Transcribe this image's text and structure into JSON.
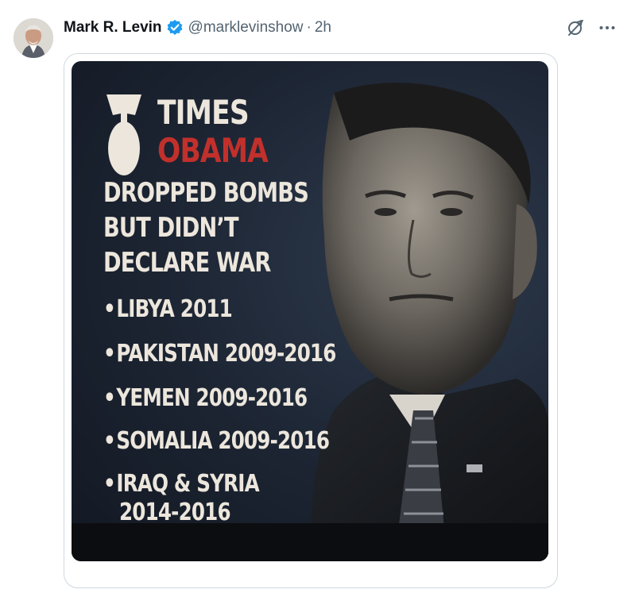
{
  "post": {
    "author": {
      "display_name": "Mark R. Levin",
      "handle": "@marklevinshow",
      "separator": "·",
      "time": "2h",
      "verified": true
    },
    "actions": {
      "grok_icon": "grok-icon",
      "more_icon": "more-icon"
    },
    "media": {
      "poster": {
        "headline_top": "TIMES",
        "headline_name": "OBAMA",
        "headline_lines": [
          "DROPPED BOMBS",
          "BUT DIDN’T",
          "DECLARE WAR"
        ],
        "bullet": "•",
        "list": [
          [
            "LIBYA 2011"
          ],
          [
            "PAKISTAN 2009-2016"
          ],
          [
            "YEMEN 2009-2016"
          ],
          [
            "SOMALIA 2009-2016"
          ],
          [
            "IRAQ & SYRIA",
            "2014-2016"
          ]
        ]
      }
    }
  },
  "colors": {
    "verified_blue": "#1d9bf0",
    "poster_red": "#c2302c",
    "poster_cream": "#ece6dc",
    "poster_background": "#1c2432"
  }
}
